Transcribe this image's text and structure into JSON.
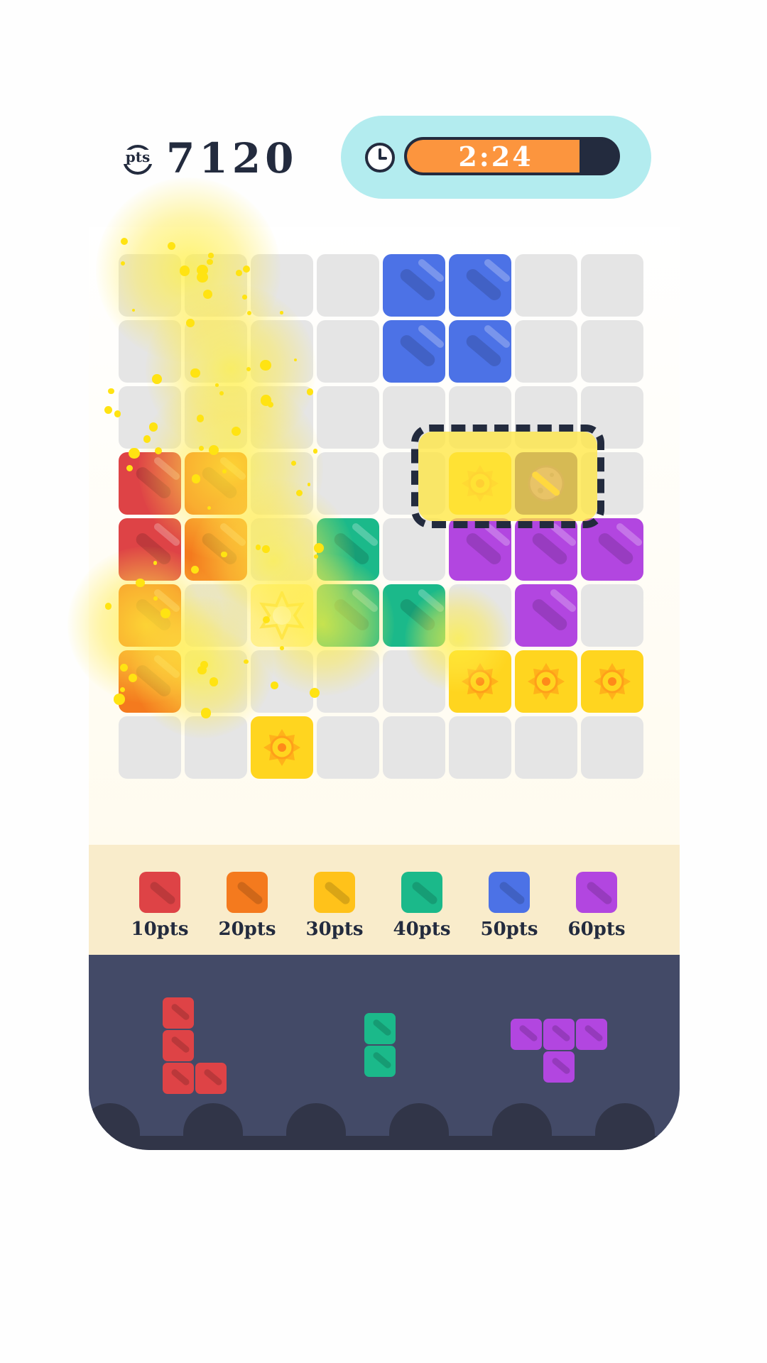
{
  "score": {
    "value": "7120",
    "icon": "pts-coin-icon"
  },
  "timer": {
    "text": "2:24",
    "remaining_fraction": 0.82,
    "icon": "clock-icon"
  },
  "colors": {
    "red": "#de4346",
    "orange": "#f47a1e",
    "yellow": "#ffc21a",
    "green": "#1bb98a",
    "blue": "#4c72e6",
    "purple": "#b246e0",
    "empty": "#e5e5e5",
    "sun": "#ffd51f",
    "navy": "#232b3e"
  },
  "board": {
    "cols": 8,
    "rows": 8,
    "cells": [
      [
        "empty",
        "empty",
        "empty",
        "empty",
        "blue",
        "blue",
        "empty",
        "empty"
      ],
      [
        "empty",
        "empty",
        "empty",
        "empty",
        "blue",
        "blue",
        "empty",
        "empty"
      ],
      [
        "empty",
        "empty",
        "empty",
        "empty",
        "empty",
        "empty",
        "empty",
        "empty"
      ],
      [
        "red",
        "orange",
        "empty",
        "empty",
        "empty",
        "sun",
        "planet",
        "empty"
      ],
      [
        "red",
        "orange",
        "empty",
        "green",
        "empty",
        "purple",
        "purple",
        "purple"
      ],
      [
        "orange",
        "empty",
        "star",
        "green",
        "green",
        "empty",
        "purple",
        "empty"
      ],
      [
        "orange",
        "empty",
        "empty",
        "empty",
        "empty",
        "sun",
        "sun",
        "sun"
      ],
      [
        "empty",
        "empty",
        "sun",
        "empty",
        "empty",
        "empty",
        "empty",
        "empty"
      ]
    ]
  },
  "legend": [
    {
      "color": "red",
      "label": "10pts"
    },
    {
      "color": "orange",
      "label": "20pts"
    },
    {
      "color": "yellow",
      "label": "30pts"
    },
    {
      "color": "green",
      "label": "40pts"
    },
    {
      "color": "blue",
      "label": "50pts"
    },
    {
      "color": "purple",
      "label": "60pts"
    }
  ],
  "tray": {
    "pieces": [
      {
        "name": "red-l-piece",
        "color": "red",
        "shape": [
          [
            0,
            0
          ],
          [
            0,
            1
          ],
          [
            0,
            2
          ],
          [
            1,
            2
          ]
        ]
      },
      {
        "name": "green-i-piece",
        "color": "green",
        "shape": [
          [
            0,
            0
          ],
          [
            0,
            1
          ]
        ]
      },
      {
        "name": "purple-t-piece",
        "color": "purple",
        "shape": [
          [
            0,
            0
          ],
          [
            1,
            0
          ],
          [
            2,
            0
          ],
          [
            1,
            1
          ]
        ]
      }
    ]
  }
}
